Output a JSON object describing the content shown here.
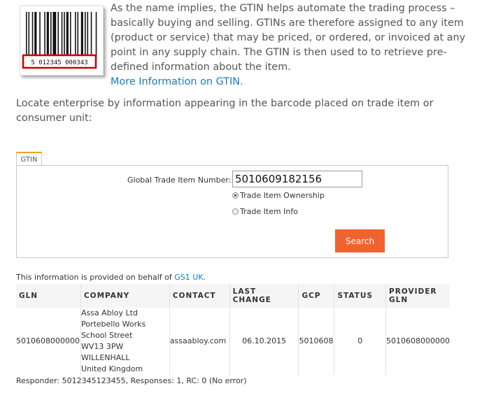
{
  "barcode": {
    "number_text": "5 012345 000343"
  },
  "intro": {
    "text": "As the name implies, the GTIN helps automate the trading process – basically buying and selling. GTINs are therefore assigned to any item (product or service) that may be priced, or ordered, or invoiced at any point in any supply chain. The GTIN is then used to to retrieve pre-defined information about the item.",
    "link_text": "More Information on GTIN."
  },
  "locate_text": "Locate enterprise by information appearing in the barcode placed on trade item or consumer unit:",
  "form": {
    "tab_label": "GTIN",
    "gtin_label": "Global Trade Item Number:",
    "gtin_value": "5010609182156",
    "radio_options": [
      {
        "label": "Trade Item Ownership",
        "checked": true
      },
      {
        "label": "Trade Item Info",
        "checked": false
      }
    ],
    "search_label": "Search"
  },
  "provided": {
    "prefix": "This information is provided on behalf of ",
    "link": "GS1 UK",
    "suffix": "."
  },
  "table": {
    "headers": [
      "GLN",
      "COMPANY",
      "CONTACT",
      "LAST CHANGE",
      "GCP",
      "STATUS",
      "PROVIDER GLN"
    ],
    "row": {
      "gln": "5010608000000",
      "company_lines": [
        "Assa Abloy Ltd",
        "Portebello Works",
        "School Street",
        "WV13 3PW",
        "WILLENHALL",
        "United Kingdom"
      ],
      "contact": "assaabloy.com",
      "last_change": "06.10.2015",
      "gcp": "5010608",
      "status": "0",
      "provider_gln": "5010608000000"
    }
  },
  "responder_text": "Responder: 5012345123455, Responses: 1, RC: 0 (No error)",
  "colors": {
    "accent": "#f06230",
    "link": "#1a7cc0",
    "tab_top": "#f0a020",
    "barcode_highlight": "#cc0000"
  }
}
